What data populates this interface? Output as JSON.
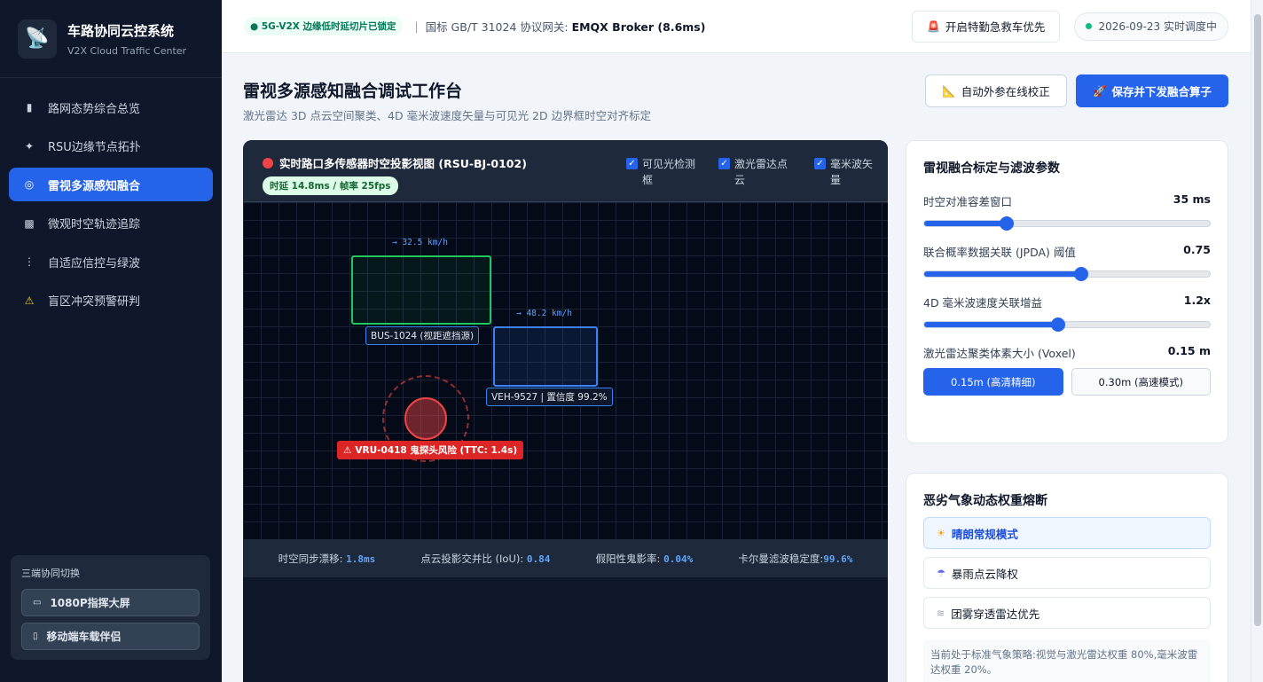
{
  "brand": {
    "title": "车路协同云控系统",
    "subtitle": "V2X Cloud Traffic Center",
    "logo_icon": "satellite-dish-icon"
  },
  "nav": [
    {
      "label": "路网态势综合总览",
      "icon": "bar-chart-icon",
      "glyph": "▮"
    },
    {
      "label": "RSU边缘节点拓扑",
      "icon": "satellite-icon",
      "glyph": "✦"
    },
    {
      "label": "雷视多源感知融合",
      "icon": "target-icon",
      "glyph": "◎",
      "active": true
    },
    {
      "label": "微观时空轨迹追踪",
      "icon": "map-icon",
      "glyph": "▩"
    },
    {
      "label": "自适应信控与绿波",
      "icon": "traffic-light-icon",
      "glyph": "⋮"
    },
    {
      "label": "盲区冲突预警研判",
      "icon": "warning-icon",
      "glyph": "⚠"
    }
  ],
  "switcher": {
    "title": "三端协同切换",
    "buttons": [
      {
        "label": "1080P指挥大屏",
        "icon": "monitor-icon",
        "glyph": "▭"
      },
      {
        "label": "移动端车载伴侣",
        "icon": "phone-icon",
        "glyph": "▯"
      }
    ]
  },
  "topbar": {
    "badge": "● 5G-V2X 边缘低时延切片已锁定",
    "separator": "|",
    "gateway_prefix": "国标 GB/T 31024 协议网关:",
    "gateway_value": "EMQX Broker (8.6ms)",
    "emergency_label": "开启特勤急救车优先",
    "emergency_icon": "siren-icon",
    "status_text": "2026-09-23 实时调度中"
  },
  "header": {
    "title": "雷视多源感知融合调试工作台",
    "subtitle": "激光雷达 3D 点云空间聚类、4D 毫米波速度矢量与可见光 2D 边界框时空对齐标定",
    "calib_label": "自动外参在线校正",
    "calib_icon": "ruler-icon",
    "save_label": "保存并下发融合算子",
    "save_icon": "rocket-icon"
  },
  "viewer": {
    "title": "实时路口多传感器时空投影视图 (RSU-BJ-0102)",
    "latency": "时延 14.8ms / 帧率 25fps",
    "toggles": [
      {
        "label": "可见光检测框",
        "checked": true
      },
      {
        "label": "激光雷达点云",
        "checked": true
      },
      {
        "label": "毫米波矢量",
        "checked": true
      }
    ],
    "objects": {
      "bus": {
        "speed": "→ 32.5 km/h",
        "label": "BUS-1024 (视距遮挡源)"
      },
      "veh": {
        "speed": "→ 48.2 km/h",
        "label": "VEH-9527 | 置信度 99.2%"
      },
      "vru": {
        "label": "VRU-0418 鬼探头风险 (TTC: 1.4s)"
      }
    },
    "metrics": [
      {
        "label": "时空同步漂移:",
        "value": "1.8ms"
      },
      {
        "label": "点云投影交并比 (IoU):",
        "value": "0.84"
      },
      {
        "label": "假阳性鬼影率:",
        "value": "0.04%"
      },
      {
        "label": "卡尔曼滤波稳定度:",
        "value": "99.6%"
      }
    ]
  },
  "params": {
    "title": "雷视融合标定与滤波参数",
    "sliders": [
      {
        "label": "时空对准容差窗口",
        "value": "35 ms",
        "fraction": 0.29
      },
      {
        "label": "联合概率数据关联 (JPDA) 阈值",
        "value": "0.75",
        "fraction": 0.55
      },
      {
        "label": "4D 毫米波速度关联增益",
        "value": "1.2x",
        "fraction": 0.47
      }
    ],
    "voxel_label": "激光雷达聚类体素大小 (Voxel)",
    "voxel_value": "0.15 m",
    "voxel_options": [
      {
        "label": "0.15m (高清精细)",
        "active": true
      },
      {
        "label": "0.30m (高速模式)",
        "active": false
      }
    ]
  },
  "weather": {
    "title": "恶劣气象动态权重熔断",
    "options": [
      {
        "label": "晴朗常规模式",
        "icon": "sun-icon",
        "glyph": "☀",
        "active": true
      },
      {
        "label": "暴雨点云降权",
        "icon": "storm-icon",
        "glyph": "☂",
        "active": false
      },
      {
        "label": "团雾穿透雷达优先",
        "icon": "fog-icon",
        "glyph": "≋",
        "active": false
      }
    ],
    "note": "当前处于标准气象策略:视觉与激光雷达权重 80%,毫米波雷达权重 20%。"
  },
  "colors": {
    "accent": "#2563eb",
    "danger": "#ef4444",
    "success": "#22c55e",
    "sidebar": "#0f172a"
  }
}
